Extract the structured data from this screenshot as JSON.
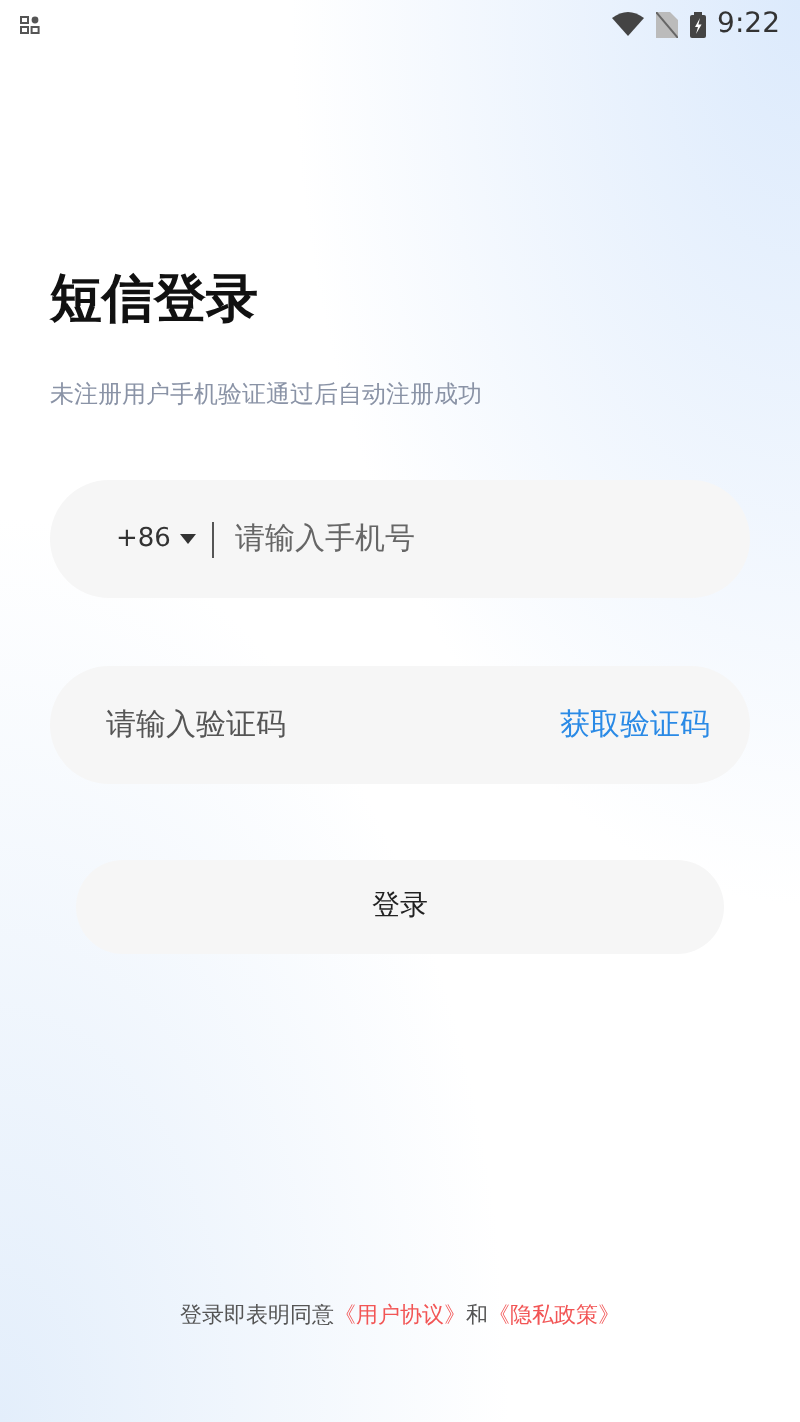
{
  "status_bar": {
    "time": "9:22"
  },
  "title": "短信登录",
  "subtitle": "未注册用户手机验证通过后自动注册成功",
  "phone_field": {
    "country_code": "+86",
    "placeholder": "请输入手机号"
  },
  "code_field": {
    "placeholder": "请输入验证码",
    "action": "获取验证码"
  },
  "login_button": "登录",
  "agreement": {
    "text_before": "登录即表明同意",
    "terms_link": "《用户协议》",
    "conjunction": "和",
    "privacy_link": "《隐私政策》"
  }
}
